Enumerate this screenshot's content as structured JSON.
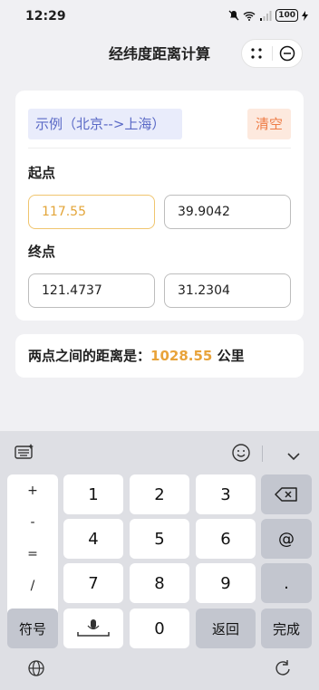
{
  "status": {
    "time": "12:29",
    "battery": "100"
  },
  "header": {
    "title": "经纬度距离计算"
  },
  "form": {
    "example_label": "示例（北京-->上海）",
    "clear_label": "清空",
    "start_label": "起点",
    "start_lng": "117.55",
    "start_lat": "39.9042",
    "end_label": "终点",
    "end_lng": "121.4737",
    "end_lat": "31.2304"
  },
  "result": {
    "prefix": "两点之间的距离是：",
    "value": "1028.55",
    "unit": "公里"
  },
  "keyboard": {
    "side_symbols": [
      "+",
      "-",
      "=",
      "/"
    ],
    "digits": [
      "1",
      "2",
      "3",
      "4",
      "5",
      "6",
      "7",
      "8",
      "9",
      "0"
    ],
    "at": "@",
    "period": ".",
    "symbols_label": "符号",
    "return_label": "返回",
    "done_label": "完成"
  }
}
